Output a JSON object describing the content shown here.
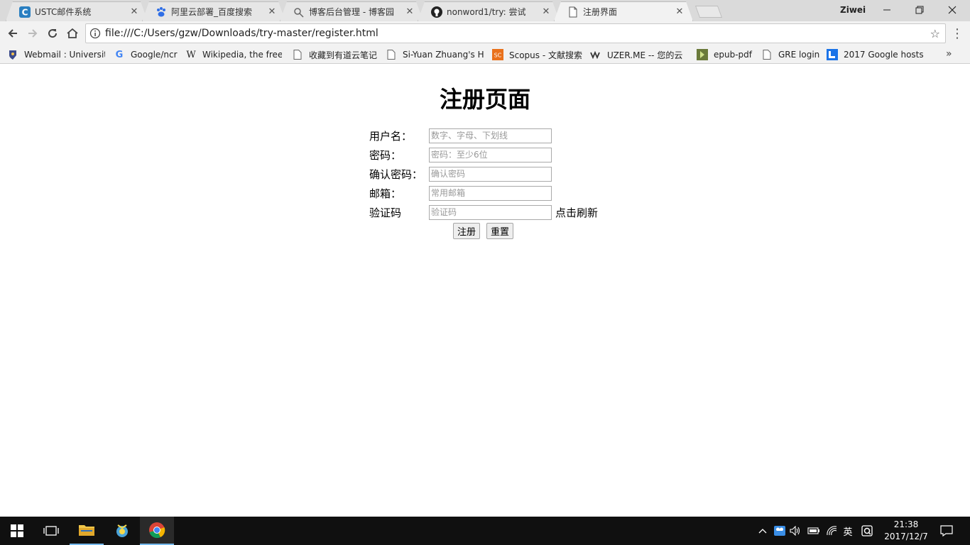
{
  "browser": {
    "tabs": [
      {
        "title": "USTC邮件系统",
        "icon": "ustc-mail-icon"
      },
      {
        "title": "阿里云部署_百度搜索",
        "icon": "baidu-paw-icon"
      },
      {
        "title": "博客后台管理 - 博客园",
        "icon": "cnblogs-icon"
      },
      {
        "title": "nonword1/try: 尝试",
        "icon": "github-icon"
      },
      {
        "title": "注册界面",
        "icon": "document-icon"
      }
    ],
    "profile_name": "Ziwei",
    "url": "file:///C:/Users/gzw/Downloads/try-master/register.html",
    "bookmarks": [
      {
        "label": "Webmail : Universit",
        "icon": "university-crest-icon"
      },
      {
        "label": "Google/ncr",
        "icon": "google-icon"
      },
      {
        "label": "Wikipedia, the free",
        "icon": "wikipedia-icon"
      },
      {
        "label": "收藏到有道云笔记",
        "icon": "document-icon"
      },
      {
        "label": "Si-Yuan Zhuang's H",
        "icon": "document-icon"
      },
      {
        "label": "Scopus - 文献搜索",
        "icon": "scopus-icon"
      },
      {
        "label": "UZER.ME -- 您的云",
        "icon": "uzer-icon"
      },
      {
        "label": "epub-pdf",
        "icon": "epub-icon"
      },
      {
        "label": "GRE login",
        "icon": "document-icon"
      },
      {
        "label": "2017 Google hosts",
        "icon": "blogger-icon"
      }
    ]
  },
  "page": {
    "title": "注册页面",
    "fields": [
      {
        "label": "用户名：",
        "placeholder": "数字、字母、下划线"
      },
      {
        "label": "密码：",
        "placeholder": "密码：至少6位"
      },
      {
        "label": "确认密码：",
        "placeholder": "确认密码"
      },
      {
        "label": "邮箱：",
        "placeholder": "常用邮箱"
      },
      {
        "label": "验证码",
        "placeholder": "验证码"
      }
    ],
    "refresh_label": "点击刷新",
    "register_button": "注册",
    "reset_button": "重置"
  },
  "taskbar": {
    "ime_label": "英",
    "time": "21:38",
    "date": "2017/12/7"
  },
  "colors": {
    "taskbar_bg": "#101010",
    "taskbar_accent": "#76b9ed",
    "tab_bar_bg": "#dadada"
  }
}
